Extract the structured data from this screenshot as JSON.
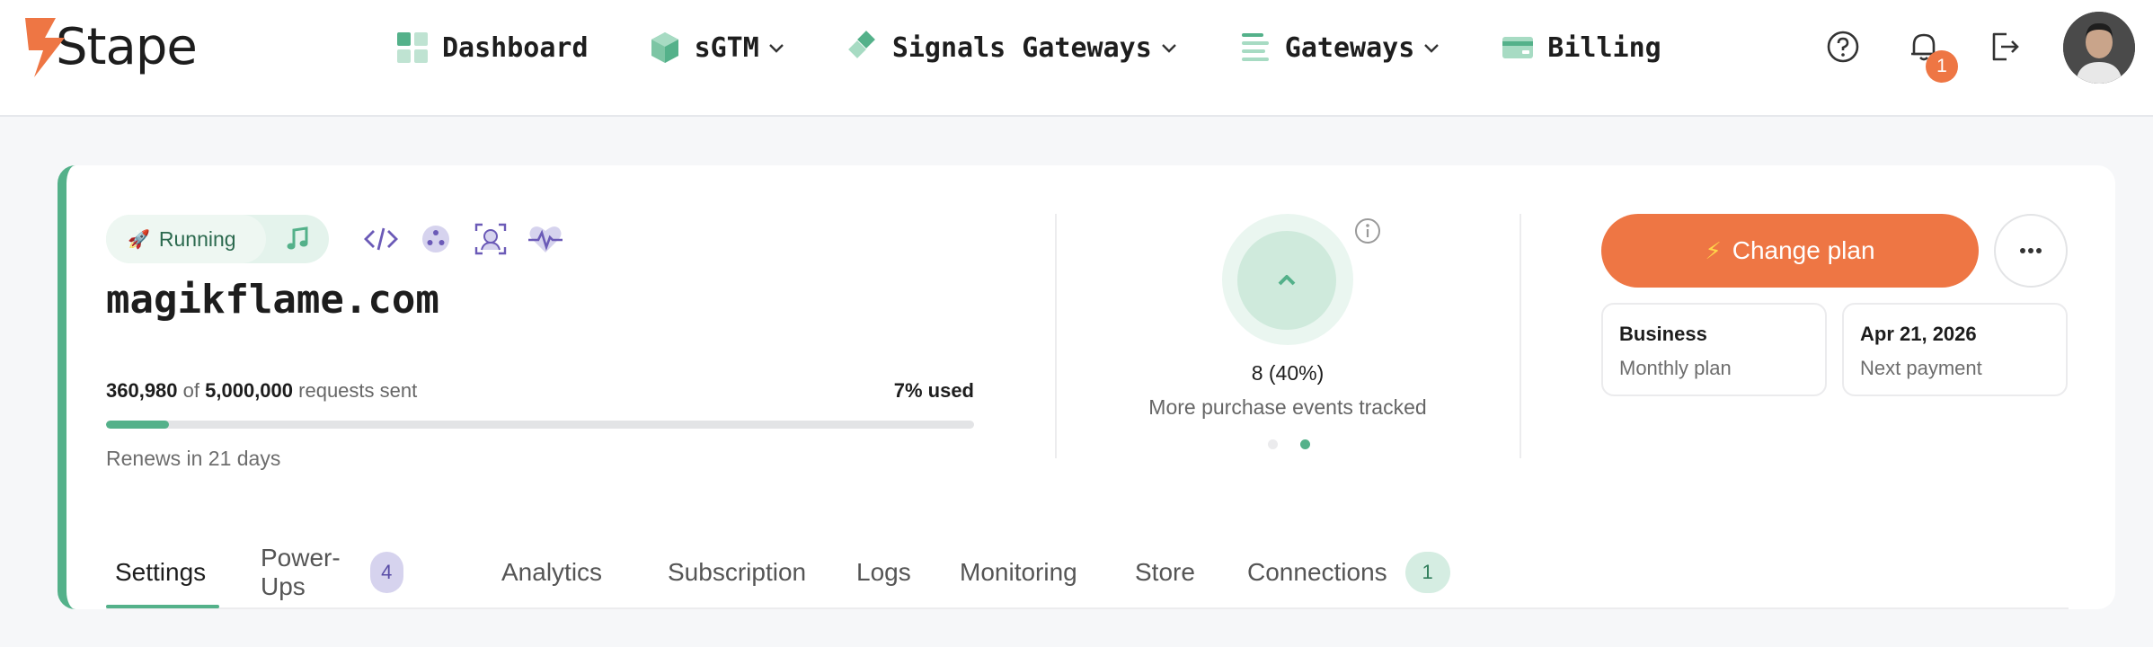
{
  "header": {
    "logo_text": "Stape",
    "nav": [
      {
        "label": "Dashboard",
        "icon": "dashboard-icon",
        "has_dropdown": false
      },
      {
        "label": "sGTM",
        "icon": "cube-icon",
        "has_dropdown": true
      },
      {
        "label": "Signals Gateways",
        "icon": "diamond-icon",
        "has_dropdown": true
      },
      {
        "label": "Gateways",
        "icon": "list-icon",
        "has_dropdown": true
      },
      {
        "label": "Billing",
        "icon": "card-icon",
        "has_dropdown": false
      }
    ],
    "notification_count": "1",
    "icons": [
      "help-icon",
      "bell-icon",
      "logout-icon"
    ]
  },
  "container": {
    "status": "Running",
    "domain": "magikflame.com",
    "usage": {
      "used": "360,980",
      "of": "of",
      "total": "5,000,000",
      "suffix": "requests sent",
      "percent_label": "7% used",
      "fraction": 0.072
    },
    "renews": "Renews in 21 days",
    "tool_icons": [
      "code-icon",
      "dots-icon",
      "face-scan-icon",
      "heartbeat-icon"
    ]
  },
  "promo": {
    "value": "8 (40%)",
    "caption": "More purchase events tracked",
    "slides": 2,
    "active_slide": 2
  },
  "plan": {
    "change_label": "Change plan",
    "plan_name": "Business",
    "plan_period": "Monthly plan",
    "next_date": "Apr 21, 2026",
    "next_label": "Next payment"
  },
  "tabs": [
    {
      "label": "Settings",
      "active": true
    },
    {
      "label": "Power-Ups",
      "badge": "4"
    },
    {
      "label": "Analytics"
    },
    {
      "label": "Subscription"
    },
    {
      "label": "Logs"
    },
    {
      "label": "Monitoring"
    },
    {
      "label": "Store"
    },
    {
      "label": "Connections",
      "badge": "1"
    }
  ],
  "colors": {
    "accent_green": "#54b18a",
    "accent_orange": "#ee7644",
    "power_ups_badge": "#d6d3ee",
    "connections_badge": "#d5ede2"
  }
}
